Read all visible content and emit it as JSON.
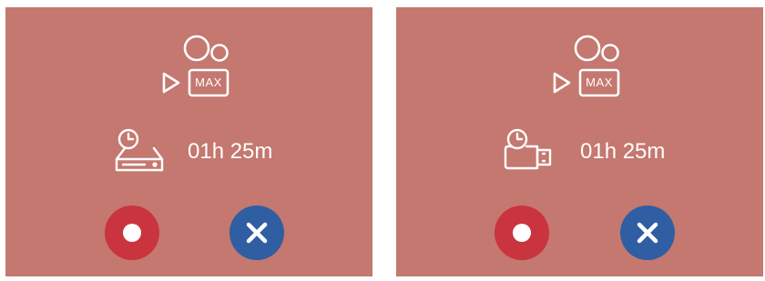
{
  "colors": {
    "panel_background": "#c4786f",
    "icon_stroke": "#ffffff",
    "record_button": "#c9343e",
    "cancel_button": "#2f5ea3"
  },
  "panels": [
    {
      "mode_icon": "camera-max-icon",
      "mode_label": "MAX",
      "storage_icon": "internal-storage-clock-icon",
      "remaining_time": "01h 25m",
      "record_button_icon": "record-icon",
      "cancel_button_icon": "close-icon"
    },
    {
      "mode_icon": "camera-max-icon",
      "mode_label": "MAX",
      "storage_icon": "usb-storage-clock-icon",
      "remaining_time": "01h 25m",
      "record_button_icon": "record-icon",
      "cancel_button_icon": "close-icon"
    }
  ]
}
